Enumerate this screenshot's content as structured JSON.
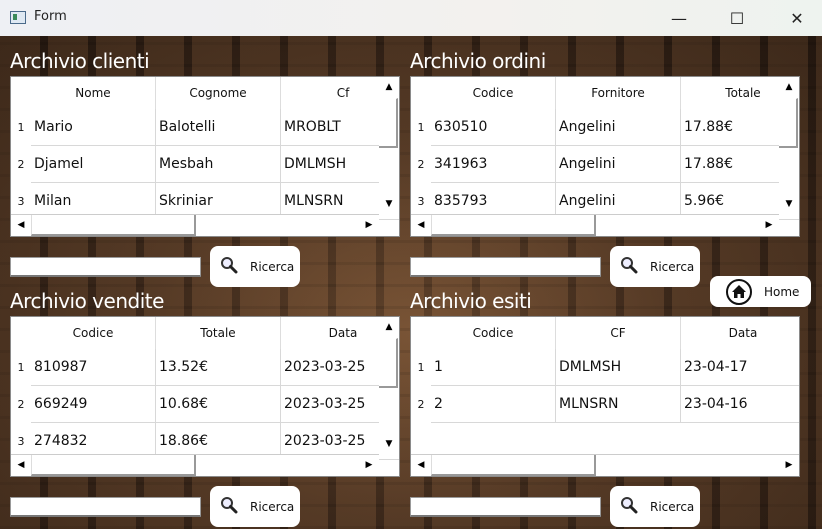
{
  "window": {
    "title": "Form",
    "minimize": "—",
    "maximize": "☐",
    "close": "✕"
  },
  "home_label": "Home",
  "search_label": "Ricerca",
  "panels": [
    {
      "id": "clienti",
      "title": "Archivio clienti",
      "columns": [
        "Nome",
        "Cognome",
        "Cf"
      ],
      "rows": [
        [
          "Mario",
          "Balotelli",
          "MROBLT"
        ],
        [
          "Djamel",
          "Mesbah",
          "DMLMSH"
        ],
        [
          "Milan",
          "Skriniar",
          "MLNSRN"
        ]
      ],
      "vscroll": true
    },
    {
      "id": "ordini",
      "title": "Archivio ordini",
      "columns": [
        "Codice",
        "Fornitore",
        "Totale"
      ],
      "rows": [
        [
          "630510",
          "Angelini",
          "17.88€"
        ],
        [
          "341963",
          "Angelini",
          "17.88€"
        ],
        [
          "835793",
          "Angelini",
          "5.96€"
        ]
      ],
      "vscroll": true
    },
    {
      "id": "vendite",
      "title": "Archivio vendite",
      "columns": [
        "Codice",
        "Totale",
        "Data"
      ],
      "rows": [
        [
          "810987",
          "13.52€",
          "2023-03-25"
        ],
        [
          "669249",
          "10.68€",
          "2023-03-25"
        ],
        [
          "274832",
          "18.86€",
          "2023-03-25"
        ]
      ],
      "vscroll": true
    },
    {
      "id": "esiti",
      "title": "Archivio esiti",
      "columns": [
        "Codice",
        "CF",
        "Data"
      ],
      "rows": [
        [
          "1",
          "DMLMSH",
          "23-04-17"
        ],
        [
          "2",
          "MLNSRN",
          "23-04-16"
        ]
      ],
      "vscroll": false
    }
  ]
}
